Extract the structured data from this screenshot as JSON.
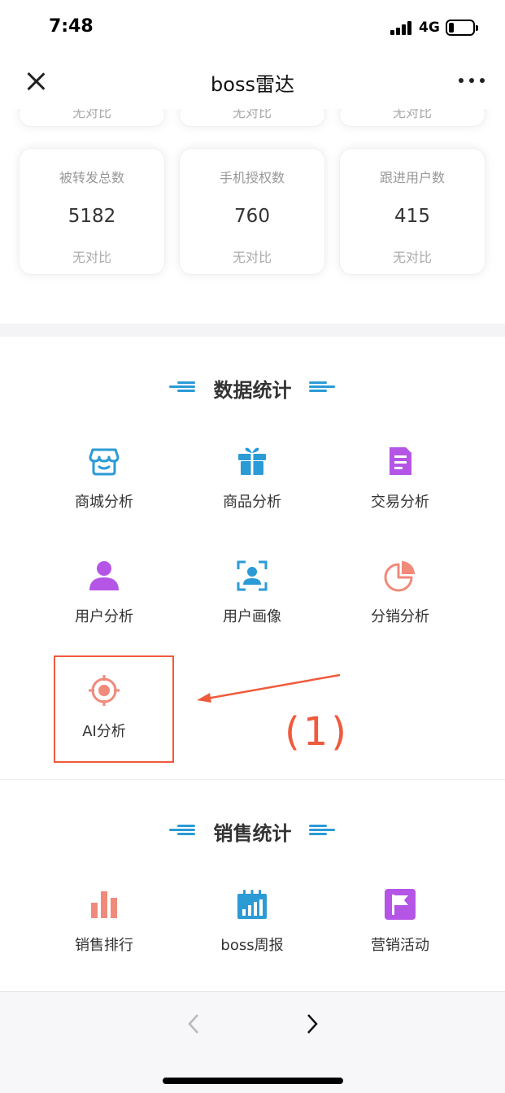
{
  "status_bar": {
    "time": "7:48",
    "network": "4G"
  },
  "nav": {
    "title": "boss雷达"
  },
  "stats_top_row": [
    {
      "compare": "无对比"
    },
    {
      "compare": "无对比"
    },
    {
      "compare": "无对比"
    }
  ],
  "stats": [
    {
      "label": "被转发总数",
      "value": "5182",
      "compare": "无对比"
    },
    {
      "label": "手机授权数",
      "value": "760",
      "compare": "无对比"
    },
    {
      "label": "跟进用户数",
      "value": "415",
      "compare": "无对比"
    }
  ],
  "data_section": {
    "title": "数据统计",
    "items": [
      {
        "label": "商城分析",
        "icon": "shop-icon"
      },
      {
        "label": "商品分析",
        "icon": "gift-icon"
      },
      {
        "label": "交易分析",
        "icon": "document-icon"
      },
      {
        "label": "用户分析",
        "icon": "user-icon"
      },
      {
        "label": "用户画像",
        "icon": "portrait-icon"
      },
      {
        "label": "分销分析",
        "icon": "pie-chart-icon"
      },
      {
        "label": "AI分析",
        "icon": "target-icon"
      }
    ]
  },
  "sales_section": {
    "title": "销售统计",
    "items": [
      {
        "label": "销售排行",
        "icon": "bar-chart-icon"
      },
      {
        "label": "boss周报",
        "icon": "calendar-chart-icon"
      },
      {
        "label": "营销活动",
        "icon": "flag-icon"
      }
    ]
  },
  "annotation": {
    "label": "(1)"
  },
  "colors": {
    "accent_blue": "#2b9bd6",
    "annotation_red": "#f05a3c",
    "purple": "#b455e6",
    "coral": "#f08a7a"
  }
}
